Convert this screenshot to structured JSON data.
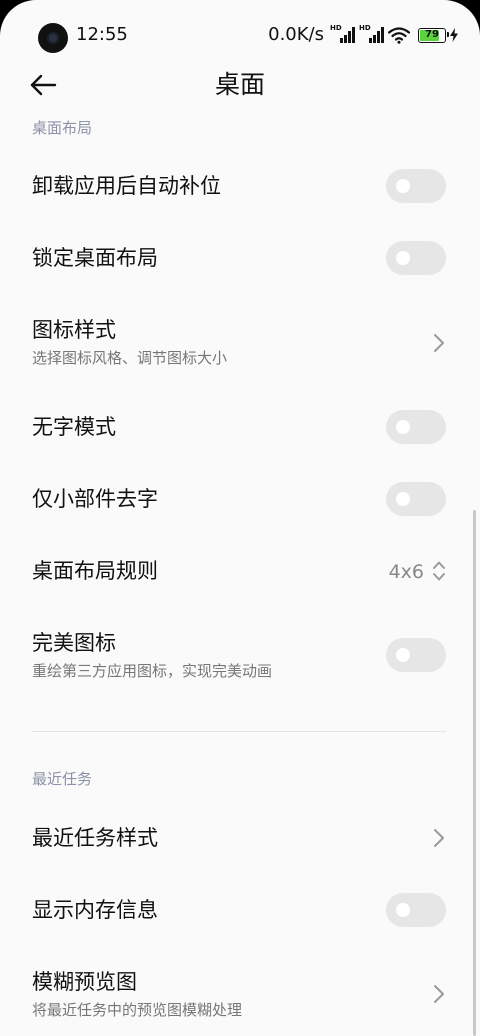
{
  "status_bar": {
    "time": "12:55",
    "net_speed": "0.0K/s",
    "signal_label_1": "HD",
    "signal_label_2": "HD",
    "battery_percent": "79",
    "battery_level": 0.79,
    "battery_color": "#5bd33a"
  },
  "header": {
    "title": "桌面",
    "back_icon": "arrow-left-icon"
  },
  "sections": {
    "desktop_layout": {
      "label": "桌面布局"
    },
    "recent_tasks": {
      "label": "最近任务"
    }
  },
  "rows": {
    "auto_fill": {
      "title": "卸载应用后自动补位",
      "toggle_on": false
    },
    "lock_layout": {
      "title": "锁定桌面布局",
      "toggle_on": false
    },
    "icon_style": {
      "title": "图标样式",
      "subtitle": "选择图标风格、调节图标大小"
    },
    "no_text_mode": {
      "title": "无字模式",
      "toggle_on": false
    },
    "widget_no_text": {
      "title": "仅小部件去字",
      "toggle_on": false
    },
    "layout_rule": {
      "title": "桌面布局规则",
      "value": "4x6"
    },
    "perfect_icons": {
      "title": "完美图标",
      "subtitle": "重绘第三方应用图标，实现完美动画",
      "toggle_on": false
    },
    "recent_style": {
      "title": "最近任务样式"
    },
    "memory_info": {
      "title": "显示内存信息",
      "toggle_on": false
    },
    "blur_preview": {
      "title": "模糊预览图",
      "subtitle": "将最近任务中的预览图模糊处理"
    }
  },
  "colors": {
    "section_header": "#8b93a8",
    "toggle_off_track": "#e6e6e6",
    "background": "#fafafa"
  }
}
